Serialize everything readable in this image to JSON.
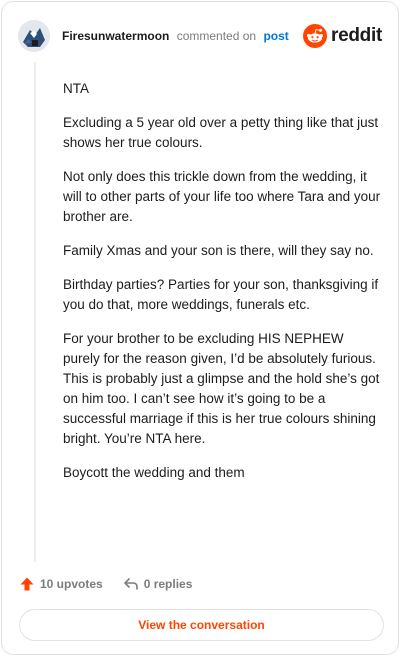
{
  "header": {
    "username": "Firesunwatermoon",
    "commented_text": "commented on",
    "post_link": "post",
    "brand": "reddit"
  },
  "comment": {
    "paragraphs": [
      "NTA",
      "Excluding a 5 year old over a petty thing like that just shows her true colours.",
      "Not only does this trickle down from the wedding, it will to other parts of your life too where Tara and your brother are.",
      "Family Xmas and your son is there, will they say no.",
      "Birthday parties? Parties for your son, thanksgiving if you do that, more weddings, funerals etc.",
      "For your brother to be excluding HIS NEPHEW purely for the reason given, I’d be absolutely furious. This is probably just a glimpse and the hold she’s got on him too. I can’t see how it’s going to be a successful marriage if this is her true colours shining bright. You’re NTA here.",
      "Boycott the wedding and them"
    ]
  },
  "actions": {
    "upvotes": "10 upvotes",
    "replies": "0 replies"
  },
  "cta": {
    "label": "View the conversation"
  },
  "colors": {
    "accent": "#ff4500",
    "link": "#0079d3",
    "muted": "#7c7c7c"
  },
  "icons": {
    "avatar": "user-avatar",
    "brand": "reddit-logo-icon",
    "upvote": "upvote-arrow-icon",
    "reply": "reply-arrow-icon"
  }
}
